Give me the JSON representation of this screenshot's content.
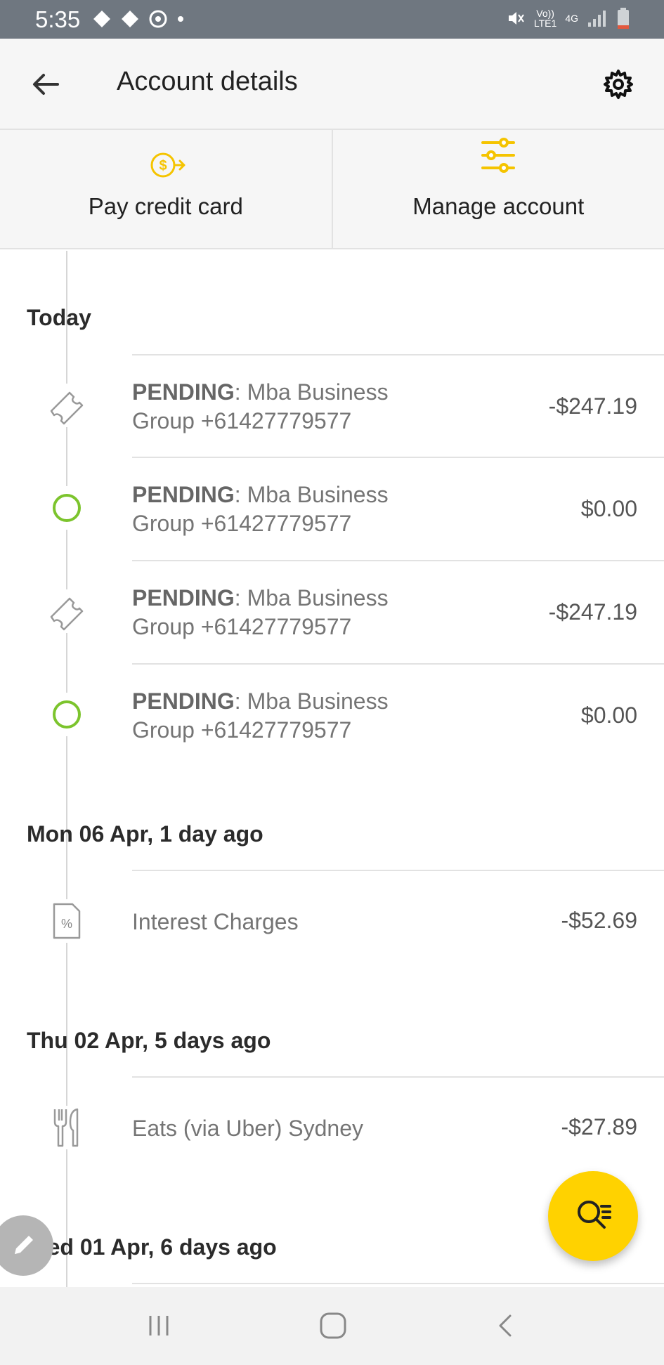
{
  "status_bar": {
    "time": "5:35",
    "network_lines": [
      "Vo))",
      "LTE1"
    ],
    "network_type": "4G"
  },
  "app_bar": {
    "back_icon": "arrow-left-icon",
    "title": "Account details",
    "settings_icon": "gear-icon"
  },
  "actions": [
    {
      "label": "Pay credit card",
      "icon": "dollar-arrow-icon"
    },
    {
      "label": "Manage account",
      "icon": "sliders-icon"
    }
  ],
  "sections": {
    "today": {
      "title": "Today",
      "items": [
        {
          "status": "PENDING",
          "description": ": Mba Business",
          "description2": "Group +61427779577",
          "amount": "-$247.19",
          "icon": "ticket-icon"
        },
        {
          "status": "PENDING",
          "description": ": Mba Business",
          "description2": "Group +61427779577",
          "amount": "$0.00",
          "icon": "circle-icon"
        },
        {
          "status": "PENDING",
          "description": ": Mba Business",
          "description2": "Group +61427779577",
          "amount": "-$247.19",
          "icon": "ticket-icon"
        },
        {
          "status": "PENDING",
          "description": ": Mba Business",
          "description2": "Group +61427779577",
          "amount": "$0.00",
          "icon": "circle-icon"
        }
      ]
    },
    "mon06": {
      "title": "Mon 06 Apr, 1 day ago",
      "items": [
        {
          "description": "Interest Charges",
          "amount": "-$52.69",
          "icon": "percent-document-icon"
        }
      ]
    },
    "thu02": {
      "title": "Thu 02 Apr, 5 days ago",
      "items": [
        {
          "description": "Eats (via Uber) Sydney",
          "amount": "-$27.89",
          "icon": "fork-knife-icon"
        }
      ]
    },
    "wed01": {
      "title": "Wed 01 Apr, 6 days ago"
    }
  },
  "fab": {
    "icon": "search-list-icon"
  },
  "edit_bubble": {
    "icon": "pencil-icon"
  },
  "nav": {
    "recents_icon": "recents-icon",
    "home_icon": "home-icon",
    "back_icon": "back-chevron-icon"
  },
  "colors": {
    "accent": "#FFD200",
    "green": "#7CC42D",
    "status_bar": "#6F7780"
  }
}
